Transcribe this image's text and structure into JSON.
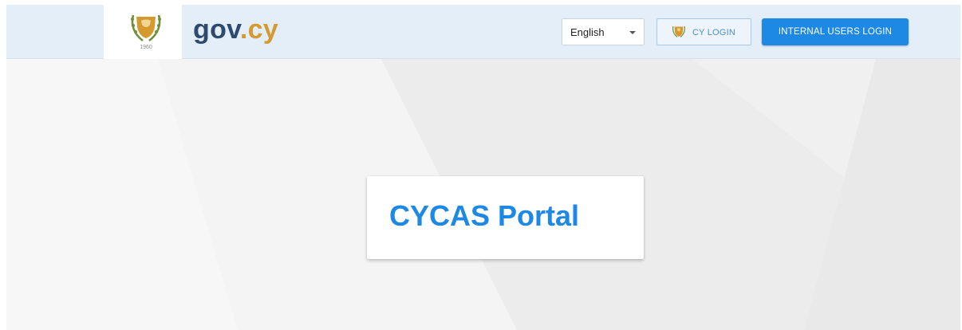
{
  "header": {
    "brand": {
      "prefix": "gov",
      "suffix": ".cy"
    },
    "emblem_icon": "cyprus-coat-of-arms-icon",
    "language_select": {
      "selected": "English"
    },
    "cy_login": {
      "label": "CY LOGIN",
      "icon": "cyprus-emblem-icon"
    },
    "internal_login": {
      "label": "INTERNAL USERS LOGIN"
    }
  },
  "main": {
    "title": "CYCAS Portal"
  },
  "colors": {
    "header_background": "#e3eef9",
    "brand_gov": "#2e4a6c",
    "brand_cy": "#d59a2f",
    "accent_blue": "#1e88e5",
    "page_background": "#f3f3f3"
  }
}
